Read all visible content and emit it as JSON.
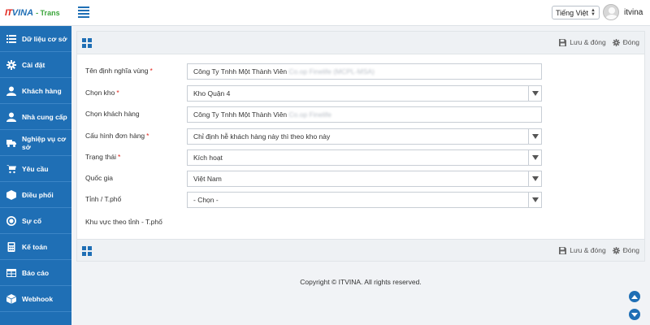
{
  "header": {
    "logo_it": "IT",
    "logo_vina": "VINA",
    "logo_trans": "- Trans",
    "language": "Tiếng Việt",
    "username": "itvina"
  },
  "sidebar": {
    "items": [
      {
        "label": "Dữ liệu cơ sở",
        "icon": "list-icon"
      },
      {
        "label": "Cài đặt",
        "icon": "gear-icon"
      },
      {
        "label": "Khách hàng",
        "icon": "user-icon"
      },
      {
        "label": "Nhà cung cấp",
        "icon": "users-icon"
      },
      {
        "label": "Nghiệp vụ cơ sở",
        "icon": "truck-icon"
      },
      {
        "label": "Yêu cầu",
        "icon": "cart-icon"
      },
      {
        "label": "Điều phối",
        "icon": "box-icon"
      },
      {
        "label": "Sự cố",
        "icon": "target-icon"
      },
      {
        "label": "Kế toán",
        "icon": "calculator-icon"
      },
      {
        "label": "Báo cáo",
        "icon": "table-icon"
      },
      {
        "label": "Webhook",
        "icon": "cube-icon"
      }
    ]
  },
  "toolbar": {
    "save_close_label": "Lưu & đóng",
    "close_label": "Đóng"
  },
  "form": {
    "definition_name": {
      "label": "Tên định nghĩa vùng",
      "required": "*",
      "value_prefix": "Công Ty Tnhh Một Thành Viên",
      "value_blurred": "Co.op Finelife (MCPL-MSA)"
    },
    "warehouse": {
      "label": "Chọn kho",
      "required": "*",
      "value": "Kho Quận 4"
    },
    "customer": {
      "label": "Chọn khách hàng",
      "value_prefix": "Công Ty Tnhh Một Thành Viên",
      "value_blurred": "Co.op Finelife"
    },
    "order_config": {
      "label": "Cấu hình đơn hàng",
      "required": "*",
      "value": "Chỉ định hễ khách hàng này thì theo kho này"
    },
    "status": {
      "label": "Trạng thái",
      "required": "*",
      "value": "Kích hoạt"
    },
    "country": {
      "label": "Quốc gia",
      "value": "Việt Nam"
    },
    "province": {
      "label": "Tỉnh / T.phố",
      "value": "- Chọn -"
    },
    "region": {
      "label": "Khu vực theo tỉnh - T.phố"
    }
  },
  "footer": {
    "copyright": "Copyright © ITVINA. All rights reserved."
  },
  "colors": {
    "brand_blue": "#1f6fb5",
    "logo_red": "#e2231a",
    "logo_green": "#3aa53a"
  }
}
